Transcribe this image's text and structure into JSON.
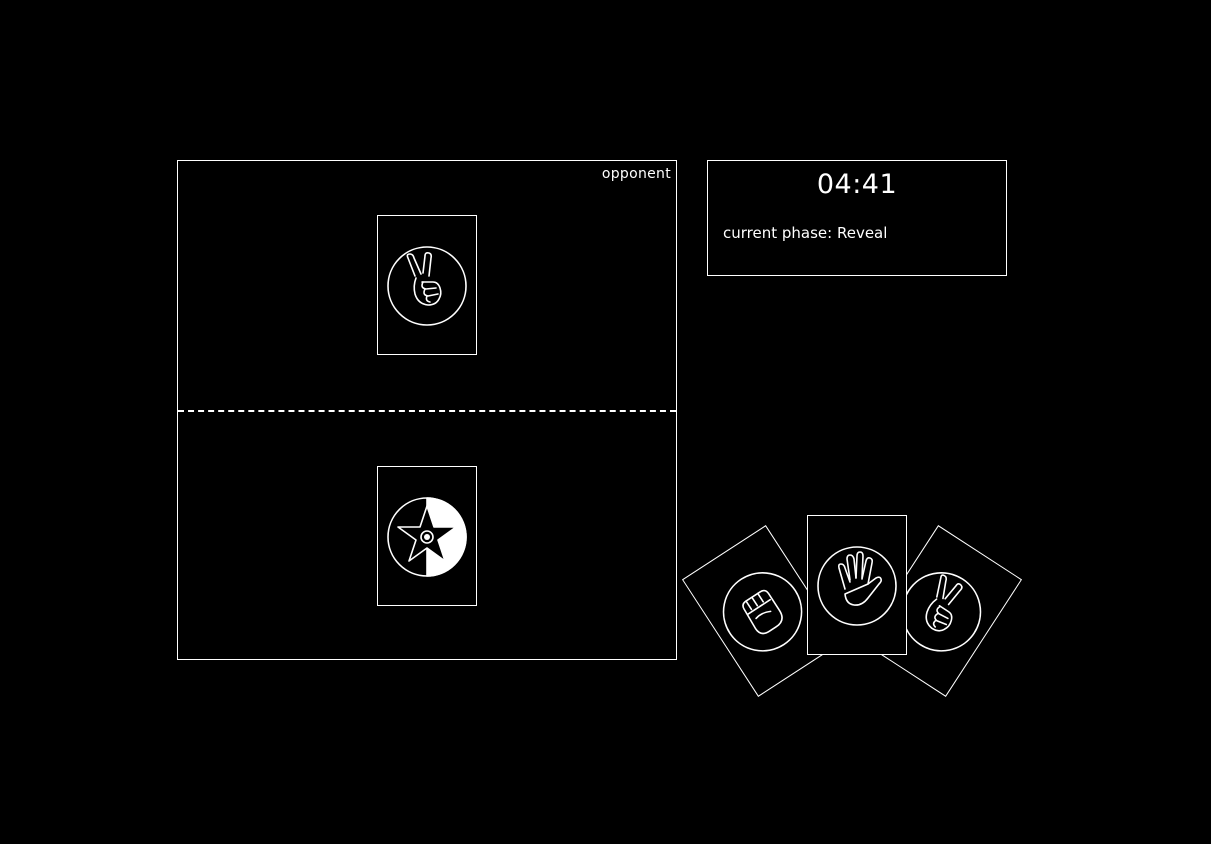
{
  "board": {
    "opponent_label": "opponent",
    "opponent_card": {
      "icon": "scissors-icon",
      "face_up": true
    },
    "player_card": {
      "icon": "wildcard-star-icon",
      "face_up": true
    }
  },
  "status": {
    "timer": "04:41",
    "phase_text": "current phase: Reveal"
  },
  "hand": [
    {
      "icon": "rock-icon",
      "name": "rock"
    },
    {
      "icon": "scissors-icon",
      "name": "scissors"
    },
    {
      "icon": "paper-icon",
      "name": "paper"
    }
  ],
  "colors": {
    "background": "#000000",
    "foreground": "#ffffff"
  }
}
